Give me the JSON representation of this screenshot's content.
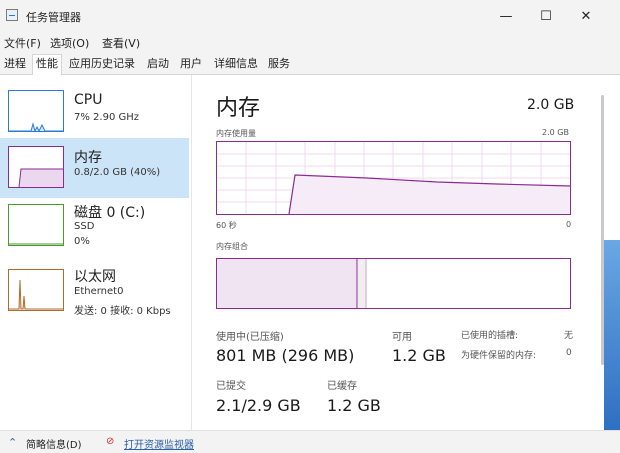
{
  "window": {
    "title": "任务管理器",
    "controls": {
      "minimize": "—",
      "maximize": "☐",
      "close": "✕"
    }
  },
  "menu": [
    "文件(F)",
    "选项(O)",
    "查看(V)"
  ],
  "tabs": [
    "进程",
    "性能",
    "应用历史记录",
    "启动",
    "用户",
    "详细信息",
    "服务"
  ],
  "active_tab": "性能",
  "resources": [
    {
      "name": "CPU",
      "sub": "7% 2.90 GHz",
      "color": "#2a7ad6",
      "icon": "cpu-graph-icon"
    },
    {
      "name": "内存",
      "sub": "0.8/2.0 GB (40%)",
      "color": "#8b2a8f",
      "icon": "memory-graph-icon"
    },
    {
      "name": "磁盘 0 (C:)",
      "sub": "SSD",
      "sub2": "0%",
      "color": "#4b9a2b",
      "icon": "disk-graph-icon"
    },
    {
      "name": "以太网",
      "sub": "Ethernet0",
      "sub2": "发送: 0 接收: 0 Kbps",
      "color": "#b06a2a",
      "icon": "ethernet-graph-icon"
    }
  ],
  "detail": {
    "title": "内存",
    "total": "2.0 GB",
    "usage_label": "内存使用量",
    "usage_max": "2.0 GB",
    "time_label": "60 秒",
    "time_min": "0",
    "composition_label": "内存组合",
    "accent": "#8b2a8f"
  },
  "stats": {
    "in_use_label": "使用中(已压缩)",
    "in_use_value": "801 MB (296 MB)",
    "available_label": "可用",
    "available_value": "1.2 GB",
    "used_slots_label": "已使用的插槽:",
    "used_slots_value": "无",
    "reserved_label": "为硬件保留的内存:",
    "reserved_value": "0",
    "committed_label": "已提交",
    "committed_value": "2.1/2.9 GB",
    "cached_label": "已缓存",
    "cached_value": "1.2 GB"
  },
  "footer": {
    "fewer_details": "简略信息(D)",
    "open_monitor": "打开资源监视器"
  }
}
